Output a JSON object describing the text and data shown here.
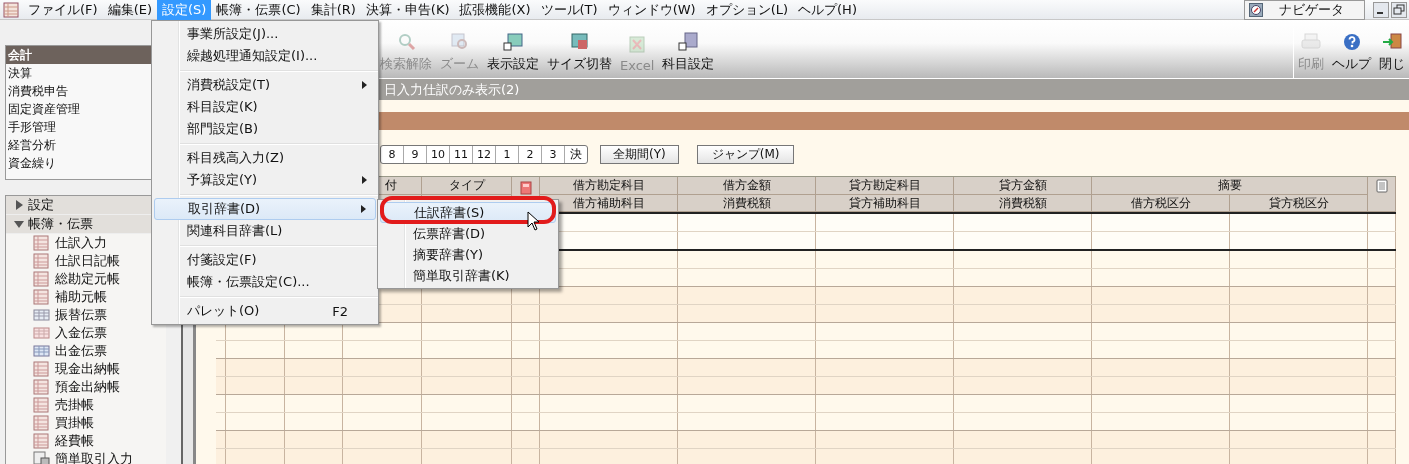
{
  "menu_bar": {
    "items": [
      {
        "label": "ファイル(F)",
        "selected": false
      },
      {
        "label": "編集(E)",
        "selected": false
      },
      {
        "label": "設定(S)",
        "selected": true
      },
      {
        "label": "帳簿・伝票(C)",
        "selected": false
      },
      {
        "label": "集計(R)",
        "selected": false
      },
      {
        "label": "決算・申告(K)",
        "selected": false
      },
      {
        "label": "拡張機能(X)",
        "selected": false
      },
      {
        "label": "ツール(T)",
        "selected": false
      },
      {
        "label": "ウィンドウ(W)",
        "selected": false
      },
      {
        "label": "オプション(L)",
        "selected": false
      },
      {
        "label": "ヘルプ(H)",
        "selected": false
      }
    ],
    "navigator_button": "ナビゲータ"
  },
  "category_panel": {
    "items": [
      {
        "label": "会計",
        "selected": true
      },
      {
        "label": "決算",
        "selected": false
      },
      {
        "label": "消費税申告",
        "selected": false
      },
      {
        "label": "固定資産管理",
        "selected": false
      },
      {
        "label": "手形管理",
        "selected": false
      },
      {
        "label": "経営分析",
        "selected": false
      },
      {
        "label": "資金繰り",
        "selected": false
      }
    ]
  },
  "tree": [
    {
      "label": "設定",
      "expanded": false
    },
    {
      "label": "帳簿・伝票",
      "expanded": true,
      "children": [
        {
          "label": "仕訳入力",
          "kind": "ledger"
        },
        {
          "label": "仕訳日記帳",
          "kind": "ledger"
        },
        {
          "label": "総勘定元帳",
          "kind": "ledger"
        },
        {
          "label": "補助元帳",
          "kind": "ledger"
        },
        {
          "label": "振替伝票",
          "kind": "transfer"
        },
        {
          "label": "入金伝票",
          "kind": "deposit"
        },
        {
          "label": "出金伝票",
          "kind": "payment"
        },
        {
          "label": "現金出納帳",
          "kind": "ledger"
        },
        {
          "label": "預金出納帳",
          "kind": "ledger"
        },
        {
          "label": "売掛帳",
          "kind": "ledger"
        },
        {
          "label": "買掛帳",
          "kind": "ledger"
        },
        {
          "label": "経費帳",
          "kind": "ledger"
        },
        {
          "label": "簡単取引入力",
          "kind": "quick"
        }
      ]
    }
  ],
  "toolbar": {
    "buttons": [
      {
        "label": "検索解除",
        "kind": "search",
        "disabled": true
      },
      {
        "label": "ズーム",
        "kind": "zoom",
        "disabled": true
      },
      {
        "label": "表示設定",
        "kind": "display",
        "disabled": false
      },
      {
        "label": "サイズ切替",
        "kind": "resize",
        "disabled": false
      },
      {
        "label": "Excel",
        "kind": "excel",
        "disabled": true
      },
      {
        "label": "科目設定",
        "kind": "accounts",
        "disabled": false
      }
    ],
    "right_buttons": [
      {
        "label": "印刷",
        "kind": "print",
        "disabled": true
      },
      {
        "label": "ヘルプ",
        "kind": "help",
        "disabled": false
      },
      {
        "label": "閉じ",
        "kind": "close",
        "disabled": false
      }
    ]
  },
  "filter_bar": {
    "label": "日入力仕訳のみ表示(2)"
  },
  "period_bar": {
    "months": [
      "8",
      "9",
      "10",
      "11",
      "12",
      "1",
      "2",
      "3",
      "決"
    ],
    "all_period_button": "全期間(Y)",
    "jump_button": "ジャンプ(M)"
  },
  "table": {
    "columns": [
      {
        "kind": "text",
        "top": "付"
      },
      {
        "kind": "text",
        "top": "タイプ"
      },
      {
        "kind": "flag"
      },
      {
        "kind": "text",
        "top": "借方勘定科目",
        "bottom": "借方補助科目"
      },
      {
        "kind": "text",
        "top": "借方金額",
        "bottom": "消費税額"
      },
      {
        "kind": "text",
        "top": "貸方勘定科目",
        "bottom": "貸方補助科目"
      },
      {
        "kind": "text",
        "top": "貸方金額",
        "bottom": "消費税額"
      },
      {
        "kind": "group",
        "top": "摘要",
        "sub": [
          "借方税区分",
          "貸方税区分"
        ]
      },
      {
        "kind": "memo"
      }
    ],
    "rows": [
      {
        "selected": true
      },
      {
        "selected": false
      },
      {
        "selected": false
      },
      {
        "selected": false
      },
      {
        "selected": false
      },
      {
        "selected": false
      },
      {
        "selected": false
      }
    ]
  },
  "settings_menu": {
    "items": [
      {
        "kind": "item",
        "label": "事業所設定(J)...",
        "selected": false
      },
      {
        "kind": "item",
        "label": "繰越処理通知設定(I)...",
        "selected": false
      },
      {
        "kind": "separator"
      },
      {
        "kind": "item",
        "label": "消費税設定(T)",
        "submenu": true,
        "selected": false
      },
      {
        "kind": "item",
        "label": "科目設定(K)",
        "selected": false
      },
      {
        "kind": "item",
        "label": "部門設定(B)",
        "selected": false
      },
      {
        "kind": "separator"
      },
      {
        "kind": "item",
        "label": "科目残高入力(Z)",
        "selected": false
      },
      {
        "kind": "item",
        "label": "予算設定(Y)",
        "submenu": true,
        "selected": false
      },
      {
        "kind": "separator"
      },
      {
        "kind": "item",
        "label": "取引辞書(D)",
        "submenu": true,
        "selected": true
      },
      {
        "kind": "item",
        "label": "関連科目辞書(L)",
        "selected": false
      },
      {
        "kind": "separator"
      },
      {
        "kind": "item",
        "label": "付箋設定(F)",
        "selected": false
      },
      {
        "kind": "item",
        "label": "帳簿・伝票設定(C)...",
        "selected": false
      },
      {
        "kind": "separator"
      },
      {
        "kind": "item",
        "label": "パレット(O)",
        "shortcut": "F2",
        "selected": false
      }
    ]
  },
  "dictionary_submenu": {
    "items": [
      {
        "label": "仕訳辞書(S)",
        "selected": true
      },
      {
        "label": "伝票辞書(D)",
        "selected": false
      },
      {
        "label": "摘要辞書(Y)",
        "selected": false
      },
      {
        "label": "簡単取引辞書(K)",
        "selected": false
      }
    ]
  }
}
